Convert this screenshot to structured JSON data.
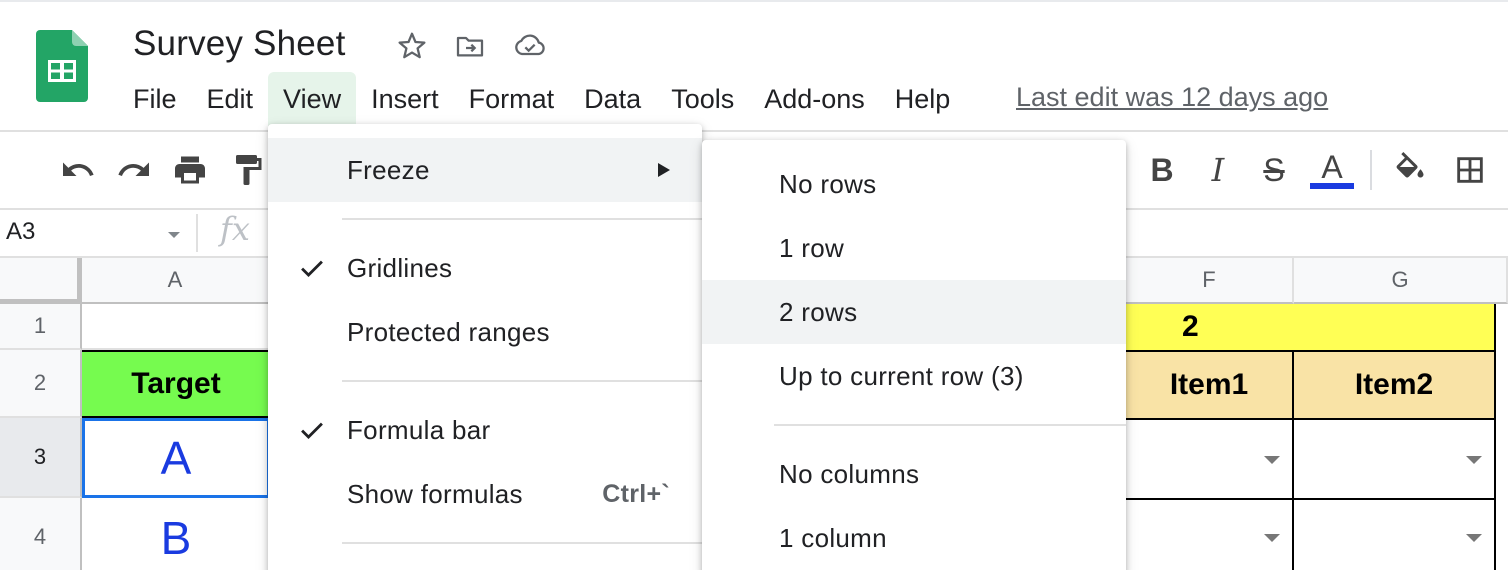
{
  "doc": {
    "title": "Survey Sheet",
    "last_edit": "Last edit was 12 days ago"
  },
  "menubar": [
    "File",
    "Edit",
    "View",
    "Insert",
    "Format",
    "Data",
    "Tools",
    "Add-ons",
    "Help"
  ],
  "active_menu": "View",
  "toolbar": {
    "bold": "B",
    "italic": "I",
    "strike": "S",
    "text_color": "A",
    "text_color_value": "#1a3be0"
  },
  "formula_bar": {
    "name_box": "A3",
    "fx": "fx"
  },
  "grid": {
    "columns": [
      "A",
      "F",
      "G"
    ],
    "rows": [
      "1",
      "2",
      "3",
      "4"
    ],
    "cells": {
      "F1": "2",
      "A2": "Target",
      "F2": "Item1",
      "G2": "Item2",
      "A3": "A",
      "A4": "B"
    },
    "colors": {
      "target_fill": "#76fb4f",
      "header_fill": "#f9e3a6",
      "yellow_fill": "#ffff55",
      "letter_blue": "#1a3be0"
    }
  },
  "view_menu": {
    "items": [
      {
        "label": "Freeze",
        "submenu": true
      },
      {
        "label": "Gridlines",
        "checked": true
      },
      {
        "label": "Protected ranges"
      },
      {
        "label": "Formula bar",
        "checked": true
      },
      {
        "label": "Show formulas",
        "shortcut": "Ctrl+`"
      }
    ]
  },
  "freeze_submenu": {
    "items": [
      "No rows",
      "1 row",
      "2 rows",
      "Up to current row (3)",
      "No columns",
      "1 column"
    ],
    "highlighted": "2 rows"
  }
}
